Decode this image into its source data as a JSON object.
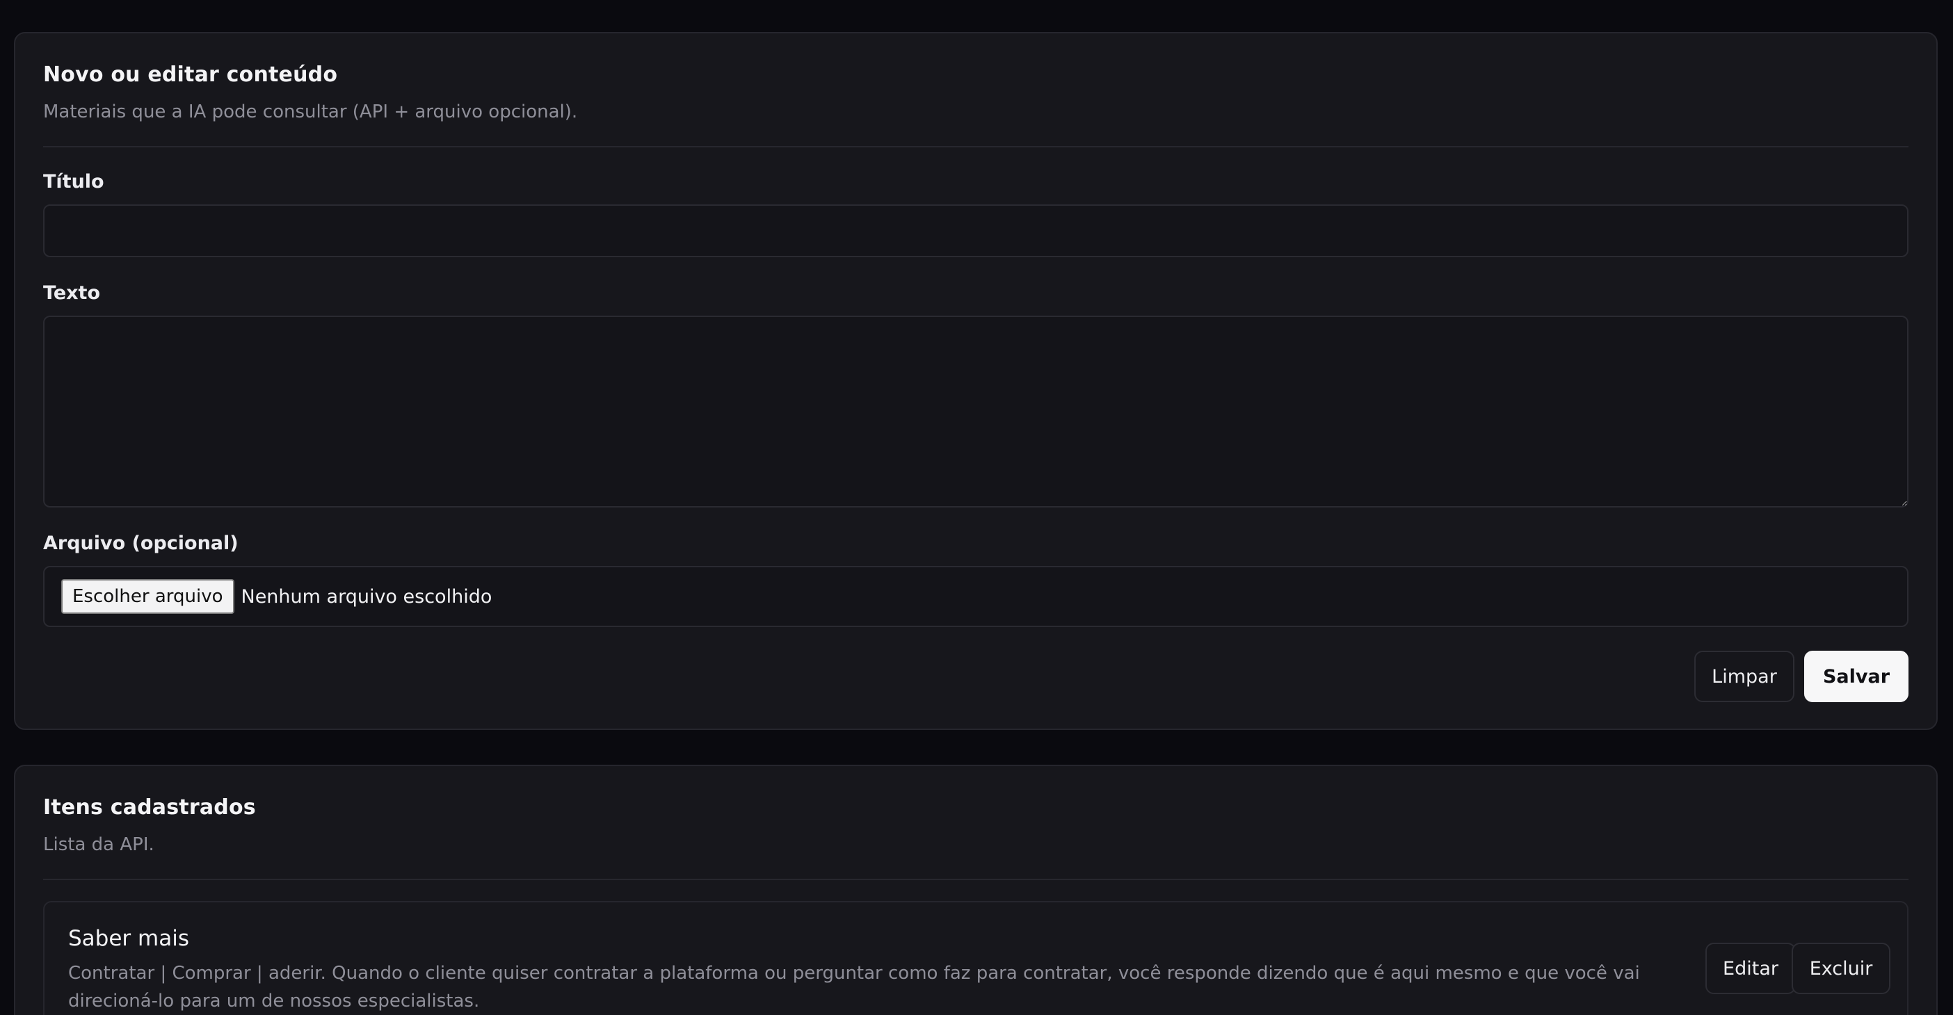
{
  "form": {
    "title": "Novo ou editar conteúdo",
    "subtitle": "Materiais que a IA pode consultar (API + arquivo opcional).",
    "title_field": {
      "label": "Título",
      "value": "",
      "placeholder": ""
    },
    "text_field": {
      "label": "Texto",
      "value": "",
      "placeholder": ""
    },
    "file_field": {
      "label": "Arquivo (opcional)",
      "button_label": "Escolher arquivo",
      "status": "Nenhum arquivo escolhido"
    },
    "clear_label": "Limpar",
    "save_label": "Salvar"
  },
  "list": {
    "title": "Itens cadastrados",
    "subtitle": "Lista da API.",
    "items": [
      {
        "title": "Saber mais",
        "text": "Contratar | Comprar | aderir. Quando o cliente quiser contratar a plataforma ou perguntar como faz para contratar, você responde dizendo que é aqui mesmo e que você vai direcioná-lo para um de nossos especialistas.",
        "edit_label": "Editar",
        "delete_label": "Excluir"
      }
    ]
  },
  "colors": {
    "background": "#0a0a0f",
    "card": "#17171c",
    "border": "#26262d",
    "primary_button": "#f7f7f8"
  }
}
